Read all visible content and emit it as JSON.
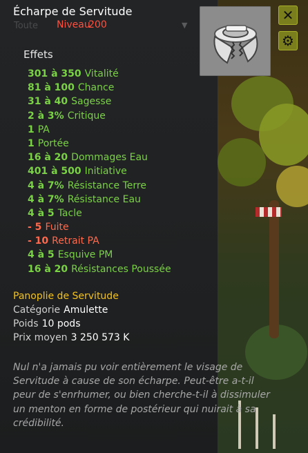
{
  "item": {
    "name": "Écharpe de Servitude",
    "level_label": "Niveau",
    "level_value": "200"
  },
  "background": {
    "ghost_text": "Toute"
  },
  "effects_title": "Effets",
  "effects": [
    {
      "value": "301 à 350",
      "label": "Vitalité",
      "type": "pos"
    },
    {
      "value": "81 à 100",
      "label": "Chance",
      "type": "pos"
    },
    {
      "value": "31 à 40",
      "label": "Sagesse",
      "type": "pos"
    },
    {
      "value": "2 à 3%",
      "label": "Critique",
      "type": "pos"
    },
    {
      "value": "1",
      "label": "PA",
      "type": "pos"
    },
    {
      "value": "1",
      "label": "Portée",
      "type": "pos"
    },
    {
      "value": "16 à 20",
      "label": "Dommages Eau",
      "type": "pos"
    },
    {
      "value": "401 à 500",
      "label": "Initiative",
      "type": "pos"
    },
    {
      "value": "4 à 7%",
      "label": "Résistance Terre",
      "type": "pos"
    },
    {
      "value": "4 à 7%",
      "label": "Résistance Eau",
      "type": "pos"
    },
    {
      "value": "4 à 5",
      "label": "Tacle",
      "type": "pos"
    },
    {
      "value": "- 5",
      "label": "Fuite",
      "type": "neg"
    },
    {
      "value": "- 10",
      "label": "Retrait PA",
      "type": "neg"
    },
    {
      "value": "4 à 5",
      "label": "Esquive PM",
      "type": "pos"
    },
    {
      "value": "16 à 20",
      "label": "Résistances Poussée",
      "type": "pos"
    }
  ],
  "set_name": "Panoplie de Servitude",
  "category": {
    "label": "Catégorie",
    "value": "Amulette"
  },
  "weight": {
    "label": "Poids",
    "value": "10 pods"
  },
  "price": {
    "label": "Prix moyen",
    "value": "3 250 573 K"
  },
  "description": "Nul n'a jamais pu voir entièrement le visage de Servitude à cause de son écharpe. Peut-être a-t-il peur de s'enrhumer, ou bien cherche-t-il à dissimuler un menton en forme de postérieur qui nuirait à sa crédibilité.",
  "buttons": {
    "close_icon": "✕",
    "settings_icon": "⚙"
  },
  "colors": {
    "positive": "#7bd246",
    "negative": "#ff6a4e",
    "set": "#f5c21a",
    "level": "#ff5040",
    "button": "#7a7e1c"
  }
}
